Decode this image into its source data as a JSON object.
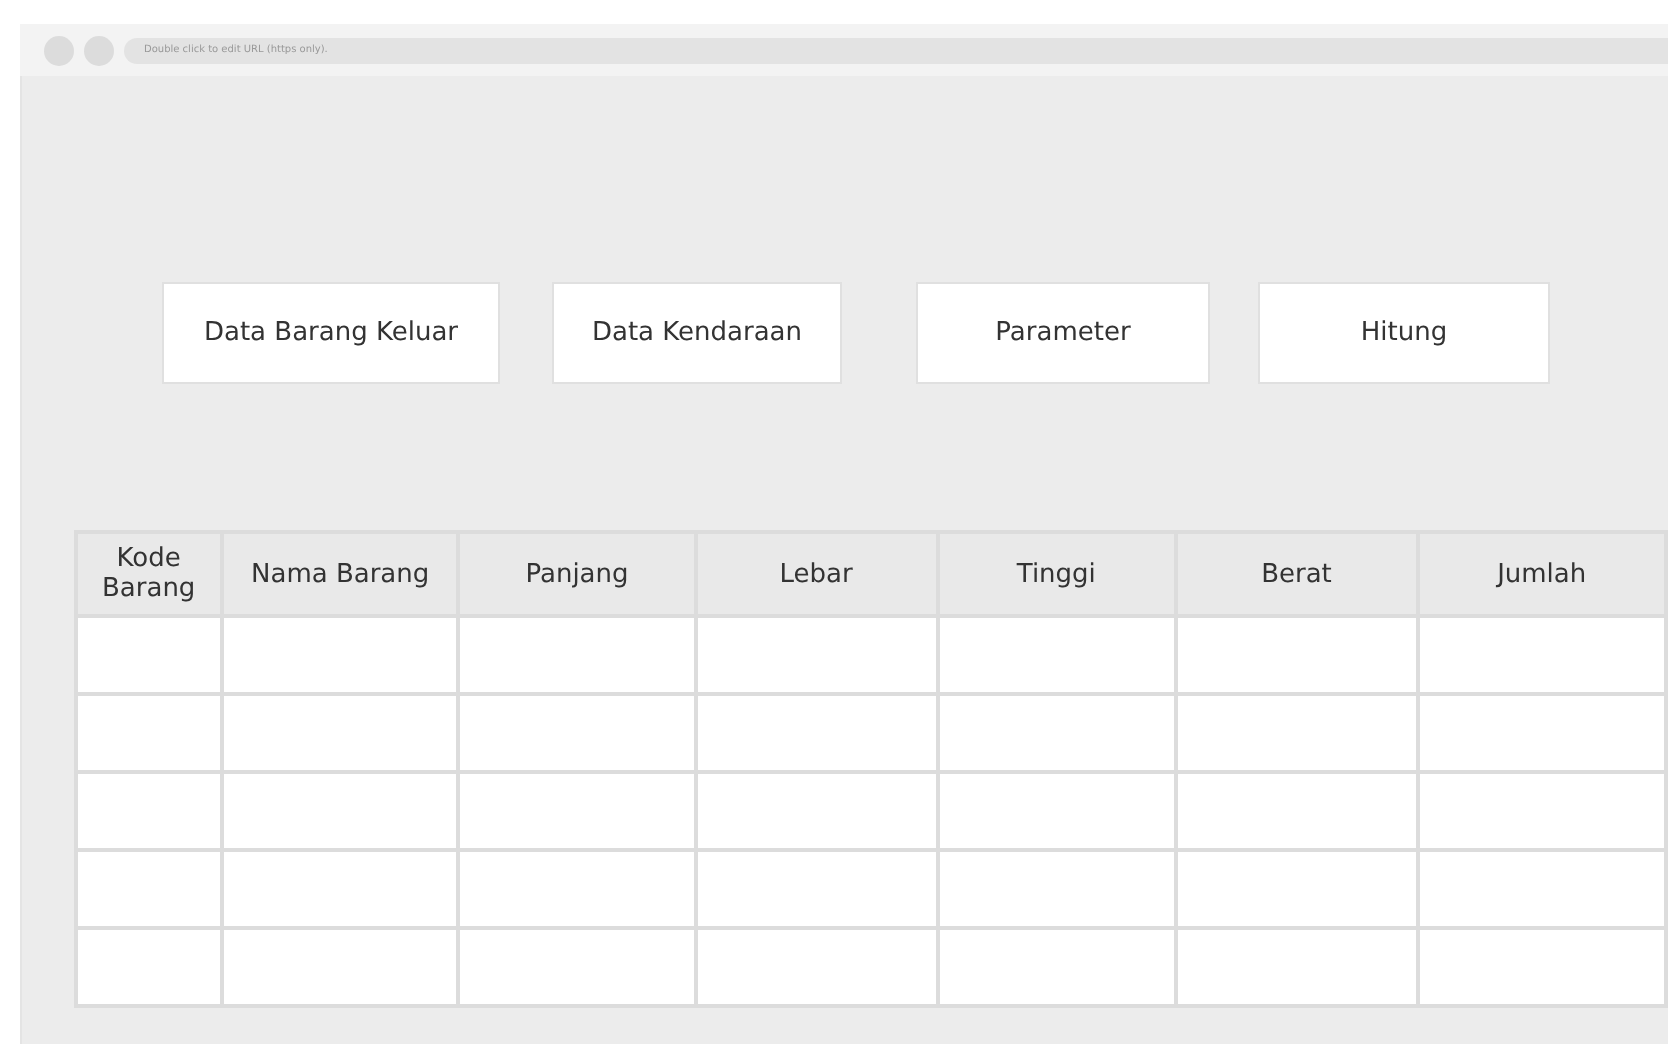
{
  "browser": {
    "url_hint": "Double click to edit URL (https only)."
  },
  "buttons": [
    "Data Barang Keluar",
    "Data Kendaraan",
    "Parameter",
    "Hitung"
  ],
  "table": {
    "columns": [
      "Kode Barang",
      "Nama Barang",
      "Panjang",
      "Lebar",
      "Tinggi",
      "Berat",
      "Jumlah"
    ]
  }
}
